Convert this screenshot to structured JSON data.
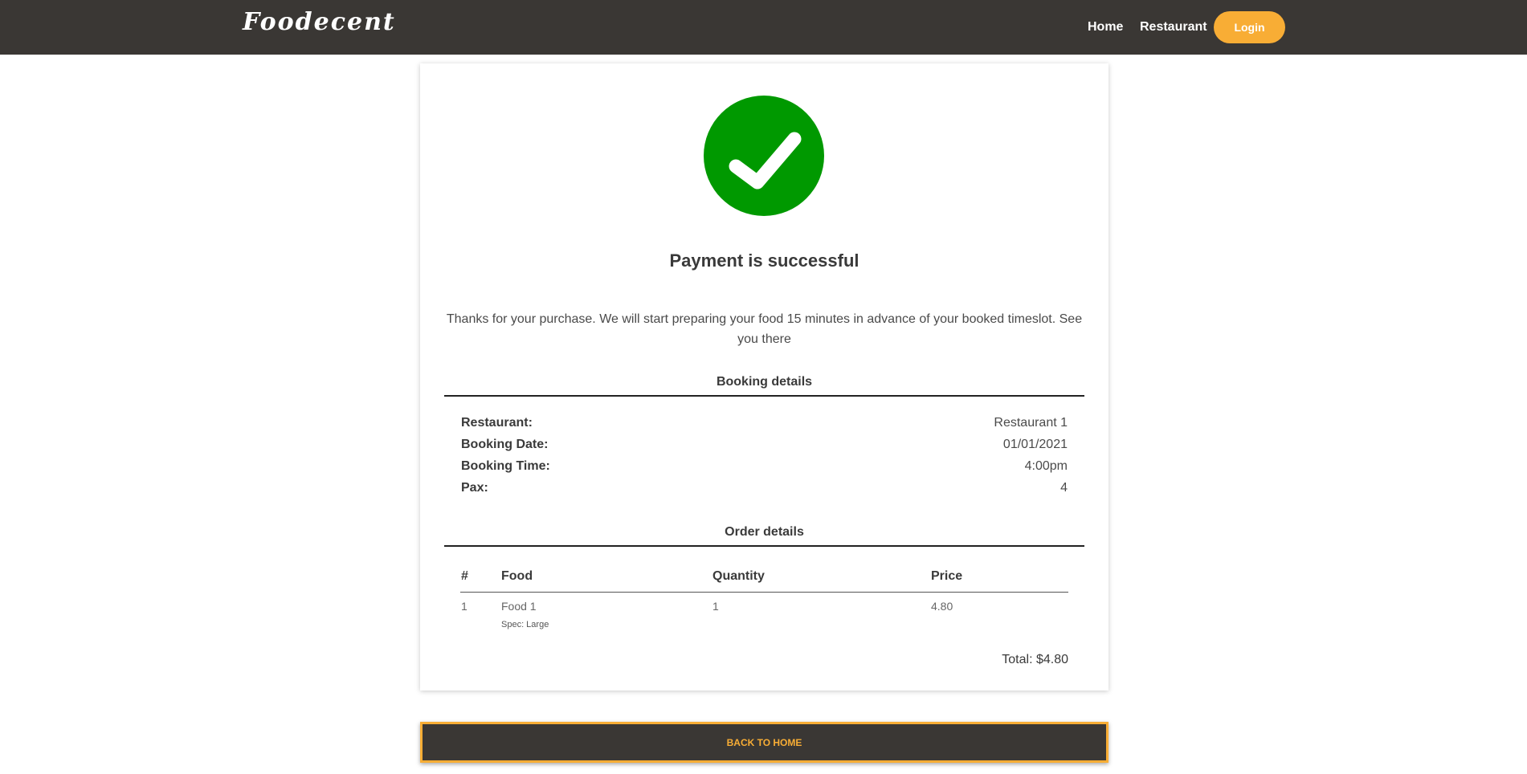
{
  "nav": {
    "brand": "Foodecent",
    "links": [
      "Home",
      "Restaurant"
    ],
    "login_label": "Login"
  },
  "status": {
    "icon": "check-circle-icon",
    "title": "Payment is successful",
    "message": "Thanks for your purchase. We will start preparing your food 15 minutes in advance of your booked timeslot. See you there"
  },
  "booking": {
    "heading": "Booking details",
    "rows": [
      {
        "label": "Restaurant:",
        "value": "Restaurant 1"
      },
      {
        "label": "Booking Date:",
        "value": "01/01/2021"
      },
      {
        "label": "Booking Time:",
        "value": "4:00pm"
      },
      {
        "label": "Pax:",
        "value": "4"
      }
    ]
  },
  "order": {
    "heading": "Order details",
    "columns": [
      "#",
      "Food",
      "Quantity",
      "Price"
    ],
    "rows": [
      {
        "index": "1",
        "food": "Food 1",
        "spec": "Spec: Large",
        "quantity": "1",
        "price": "4.80"
      }
    ],
    "total": "Total: $4.80"
  },
  "back_label": "BACK TO HOME",
  "colors": {
    "navbar": "#3a3734",
    "accent": "#f8ad35",
    "success": "#009900"
  }
}
